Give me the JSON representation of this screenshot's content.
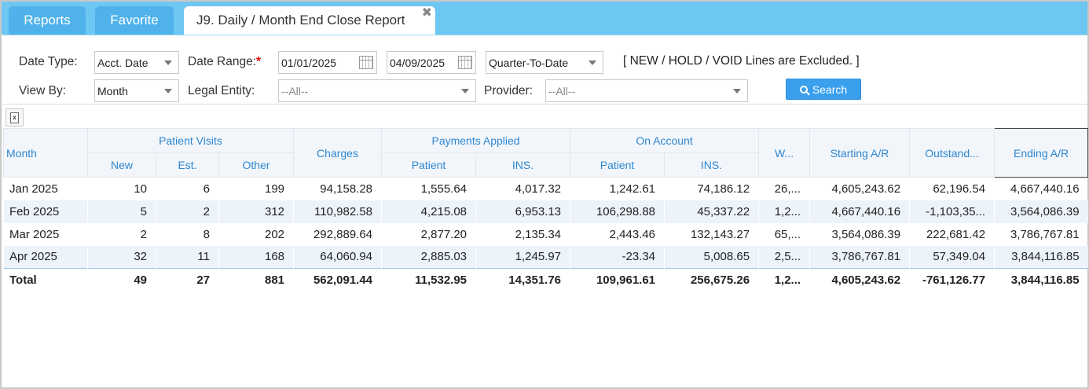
{
  "tabs": {
    "reports": "Reports",
    "favorite": "Favorite",
    "report": "J9. Daily / Month End Close Report",
    "close": "✖"
  },
  "filters": {
    "date_type_label": "Date Type:",
    "date_type_value": "Acct. Date",
    "date_range_label": "Date Range:",
    "required_mark": "*",
    "date_from": "01/01/2025",
    "date_to": "04/09/2025",
    "period_value": "Quarter-To-Date",
    "excluded_note": "[ NEW / HOLD / VOID Lines are Excluded. ]",
    "view_by_label": "View By:",
    "view_by_value": "Month",
    "legal_entity_label": "Legal Entity:",
    "legal_entity_value": "--All--",
    "provider_label": "Provider:",
    "provider_value": "--All--",
    "search_label": "Search"
  },
  "toolbar": {
    "export_icon_text": "x"
  },
  "table": {
    "headers": {
      "month": "Month",
      "patient_visits": "Patient Visits",
      "new": "New",
      "est": "Est.",
      "other": "Other",
      "charges": "Charges",
      "payments_applied": "Payments Applied",
      "pay_patient": "Patient",
      "pay_ins": "INS.",
      "on_account": "On Account",
      "oa_patient": "Patient",
      "oa_ins": "INS.",
      "w": "W...",
      "starting_ar": "Starting A/R",
      "outstanding": "Outstand...",
      "ending_ar": "Ending A/R"
    },
    "rows": [
      {
        "month": "Jan 2025",
        "new": "10",
        "est": "6",
        "other": "199",
        "charges": "94,158.28",
        "pay_patient": "1,555.64",
        "pay_ins": "4,017.32",
        "oa_patient": "1,242.61",
        "oa_ins": "74,186.12",
        "w": "26,...",
        "starting_ar": "4,605,243.62",
        "outstanding": "62,196.54",
        "ending_ar": "4,667,440.16"
      },
      {
        "month": "Feb 2025",
        "new": "5",
        "est": "2",
        "other": "312",
        "charges": "110,982.58",
        "pay_patient": "4,215.08",
        "pay_ins": "6,953.13",
        "oa_patient": "106,298.88",
        "oa_ins": "45,337.22",
        "w": "1,2...",
        "starting_ar": "4,667,440.16",
        "outstanding": "-1,103,35...",
        "ending_ar": "3,564,086.39"
      },
      {
        "month": "Mar 2025",
        "new": "2",
        "est": "8",
        "other": "202",
        "charges": "292,889.64",
        "pay_patient": "2,877.20",
        "pay_ins": "2,135.34",
        "oa_patient": "2,443.46",
        "oa_ins": "132,143.27",
        "w": "65,...",
        "starting_ar": "3,564,086.39",
        "outstanding": "222,681.42",
        "ending_ar": "3,786,767.81"
      },
      {
        "month": "Apr 2025",
        "new": "32",
        "est": "11",
        "other": "168",
        "charges": "64,060.94",
        "pay_patient": "2,885.03",
        "pay_ins": "1,245.97",
        "oa_patient": "-23.34",
        "oa_ins": "5,008.65",
        "w": "2,5...",
        "starting_ar": "3,786,767.81",
        "outstanding": "57,349.04",
        "ending_ar": "3,844,116.85"
      }
    ],
    "total": {
      "month": "Total",
      "new": "49",
      "est": "27",
      "other": "881",
      "charges": "562,091.44",
      "pay_patient": "11,532.95",
      "pay_ins": "14,351.76",
      "oa_patient": "109,961.61",
      "oa_ins": "256,675.26",
      "w": "1,2...",
      "starting_ar": "4,605,243.62",
      "outstanding": "-761,126.77",
      "ending_ar": "3,844,116.85"
    }
  },
  "colors": {
    "tabbar": "#6ec6f2",
    "tab": "#4fb2ea",
    "header_text": "#2e86cf",
    "search_button": "#3aa0ee",
    "row_alt": "#edf3fb"
  }
}
